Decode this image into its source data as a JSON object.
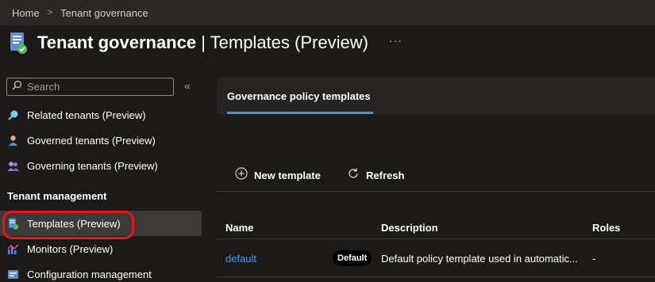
{
  "breadcrumb": {
    "home": "Home",
    "separator": ">",
    "current": "Tenant governance"
  },
  "header": {
    "title_bold": "Tenant governance",
    "title_rest": " | Templates (Preview)",
    "more": "···",
    "icon": "tenant-governance-icon"
  },
  "sidebar": {
    "search_placeholder": "Search",
    "collapse": "«",
    "items_top": [
      {
        "label": "Related tenants (Preview)",
        "icon": "search-tenant-icon"
      },
      {
        "label": "Governed tenants (Preview)",
        "icon": "person-icon"
      },
      {
        "label": "Governing tenants (Preview)",
        "icon": "people-icon"
      }
    ],
    "section_header": "Tenant management",
    "items_section": [
      {
        "label": "Templates (Preview)",
        "icon": "template-icon",
        "active": true
      },
      {
        "label": "Monitors (Preview)",
        "icon": "monitor-chart-icon"
      },
      {
        "label": "Configuration management",
        "icon": "configuration-icon"
      }
    ]
  },
  "main": {
    "tab": "Governance policy templates",
    "toolbar": {
      "new_template": "New template",
      "refresh": "Refresh"
    },
    "table": {
      "columns": [
        "Name",
        "Description",
        "Roles"
      ],
      "rows": [
        {
          "name": "default",
          "badge": "Default",
          "description": "Default policy template used in automatic...",
          "roles": "-"
        }
      ]
    }
  },
  "colors": {
    "accent": "#4f8fd6",
    "link": "#4f9ae8",
    "highlight": "#e8151b",
    "background": "#1b1a19"
  }
}
